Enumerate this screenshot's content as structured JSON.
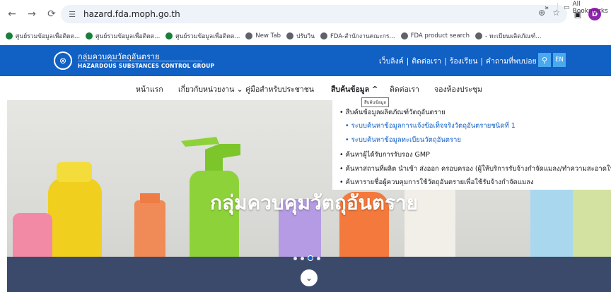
{
  "browser": {
    "url": "hazard.fda.moph.go.th",
    "bookmarks": [
      {
        "label": "ศูนย์รวมข้อมูลเพื่อติดต...",
        "color": "#188038"
      },
      {
        "label": "ศูนย์รวมข้อมูลเพื่อติดต...",
        "color": "#188038"
      },
      {
        "label": "ศูนย์รวมข้อมูลเพื่อติดต...",
        "color": "#188038"
      },
      {
        "label": "New Tab",
        "color": "#5f6368"
      },
      {
        "label": "ปรับวิน",
        "color": "#5f6368"
      },
      {
        "label": "FDA-สำนักงานคณะกร...",
        "color": "#5f6368"
      },
      {
        "label": "FDA product search",
        "color": "#5f6368"
      },
      {
        "label": "- ทะเบียนผลิตภัณฑ์...",
        "color": "#5f6368"
      }
    ],
    "bookmarks_overflow": "»",
    "all_bookmarks": "All Bookmarks"
  },
  "header": {
    "brand_th": "กลุ่มควบคุมวัตถุอันตราย",
    "brand_en": "HAZARDOUS SUBSTANCES CONTROL GROUP",
    "links": [
      "เว็บลิงค์",
      "ติดต่อเรา",
      "ร้องเรียน",
      "คำถามที่พบบ่อย"
    ],
    "lang": "EN",
    "accent": "#1160c4"
  },
  "nav": {
    "items": [
      "หน้าแรก",
      "เกี่ยวกับหน่วยงาน",
      "คู่มือสำหรับประชาชน",
      "สืบค้นข้อมูล",
      "ติดต่อเรา",
      "จองห้องประชุม"
    ],
    "tooltip": "สืบค้นข้อมูล"
  },
  "dropdown": {
    "items": [
      {
        "label": "สืบค้นข้อมูลผลิตภัณฑ์วัตถุอันตราย",
        "sub": false
      },
      {
        "label": "ระบบค้นหาข้อมูลการแจ้งข้อเท็จจริงวัตถุอันตรายชนิดที่ 1",
        "sub": true
      },
      {
        "label": "ระบบค้นหาข้อมูลทะเบียนวัตถุอันตราย",
        "sub": true
      },
      {
        "label": "ค้นหาผู้ได้รับการรับรอง GMP",
        "sub": false
      },
      {
        "label": "ค้นหาสถานที่ผลิต นำเข้า ส่งออก ครอบครอง (ผู้ให้บริการรับจ้างกำจัดแมลง/ทำความสะอาดในบ้าน",
        "sub": false
      },
      {
        "label": "ค้นหารายชื่อผู้ควบคุมการใช้วัตถุอันตรายเพื่อใช้รับจ้างกำจัดแมลง",
        "sub": false
      }
    ]
  },
  "hero": {
    "title": "กลุ่มควบคุมวัตถุอันตราย",
    "slide_count": 4,
    "active_slide": 3
  }
}
